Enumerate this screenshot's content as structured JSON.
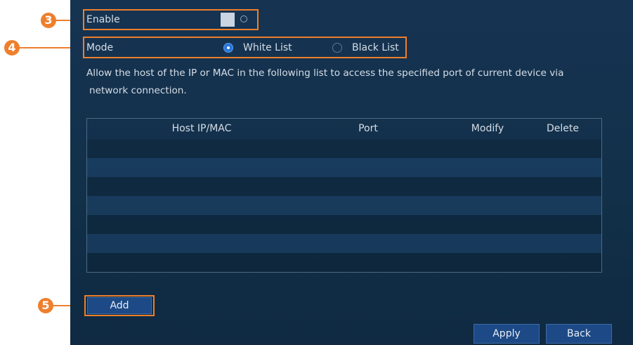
{
  "callouts": {
    "enable_num": "3",
    "mode_num": "4",
    "add_num": "5"
  },
  "enable": {
    "label": "Enable",
    "on": true
  },
  "mode": {
    "label": "Mode",
    "options": [
      {
        "label": "White List",
        "selected": true
      },
      {
        "label": "Black List",
        "selected": false
      }
    ]
  },
  "description": {
    "line1": "Allow the host of the IP or MAC in the following list to access the specified port of current device via",
    "line2": "network connection."
  },
  "table": {
    "columns": [
      "Host IP/MAC",
      "Port",
      "Modify",
      "Delete"
    ],
    "rows": []
  },
  "buttons": {
    "add": "Add",
    "apply": "Apply",
    "back": "Back"
  },
  "colors": {
    "accent": "#ee7f2c",
    "panel": "#163452",
    "button": "#1d4a86"
  }
}
